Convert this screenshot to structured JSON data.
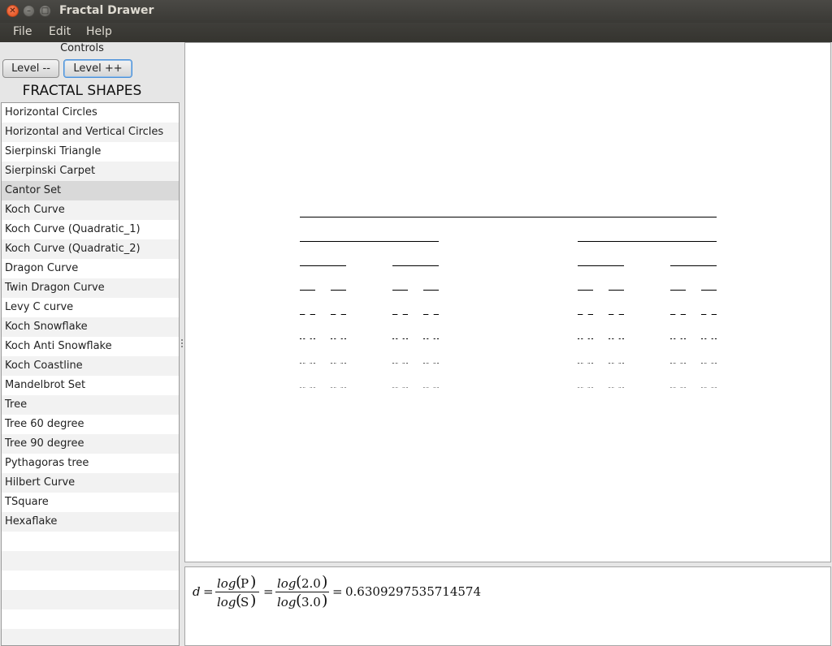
{
  "window": {
    "title": "Fractal Drawer"
  },
  "menu": {
    "file": "File",
    "edit": "Edit",
    "help": "Help"
  },
  "controls": {
    "label": "Controls",
    "level_down": "Level --",
    "level_up": "Level ++"
  },
  "shapes": {
    "title": "FRACTAL SHAPES",
    "selected": "Cantor Set",
    "items": [
      "Horizontal Circles",
      "Horizontal and Vertical Circles",
      "Sierpinski Triangle",
      "Sierpinski Carpet",
      "Cantor Set",
      "Koch Curve",
      "Koch Curve (Quadratic_1)",
      "Koch Curve (Quadratic_2)",
      "Dragon Curve",
      "Twin Dragon Curve",
      "Levy C curve",
      "Koch Snowflake",
      "Koch Anti Snowflake",
      "Koch Coastline",
      "Mandelbrot Set",
      "Tree",
      "Tree 60 degree",
      "Tree 90 degree",
      "Pythagoras tree",
      "Hilbert Curve",
      "TSquare",
      "Hexaflake"
    ]
  },
  "cantor": {
    "levels": 8
  },
  "formula": {
    "d": "d",
    "eq": "=",
    "log": "log",
    "p": "P",
    "s": "S",
    "p_val": "2.0",
    "s_val": "3.0",
    "result": "0.6309297535714574"
  }
}
